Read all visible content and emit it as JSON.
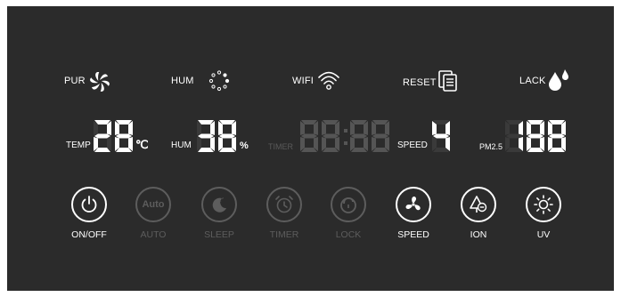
{
  "indicators": {
    "pur": {
      "label": "PUR",
      "icon": "fan-swirl-icon"
    },
    "hum": {
      "label": "HUM",
      "icon": "dots-ring-icon"
    },
    "wifi": {
      "label": "WIFI",
      "icon": "wifi-icon"
    },
    "reset": {
      "label": "RESET",
      "icon": "filter-reset-icon"
    },
    "lack": {
      "label": "LACK",
      "icon": "water-drops-icon"
    }
  },
  "readouts": {
    "temp": {
      "label": "TEMP",
      "value": "28",
      "unit": "℃"
    },
    "hum": {
      "label": "HUM",
      "value": "38",
      "unit": "%"
    },
    "timer": {
      "label": "TIMER",
      "value": "88:88"
    },
    "speed": {
      "label": "SPEED",
      "value": "4"
    },
    "pm25": {
      "label": "PM2.5",
      "value": "188"
    }
  },
  "buttons": [
    {
      "id": "onoff",
      "label": "ON/OFF",
      "icon": "power-icon",
      "active": true
    },
    {
      "id": "auto",
      "label": "AUTO",
      "icon": "auto-icon",
      "inner": "Auto",
      "active": false
    },
    {
      "id": "sleep",
      "label": "SLEEP",
      "icon": "moon-icon",
      "active": false
    },
    {
      "id": "timer",
      "label": "TIMER",
      "icon": "alarm-clock-icon",
      "active": false
    },
    {
      "id": "lock",
      "label": "LOCK",
      "icon": "lock-icon",
      "active": false
    },
    {
      "id": "speed",
      "label": "SPEED",
      "icon": "fan-icon",
      "active": true
    },
    {
      "id": "ion",
      "label": "ION",
      "icon": "ion-tree-icon",
      "active": true
    },
    {
      "id": "uv",
      "label": "UV",
      "icon": "sun-icon",
      "active": true
    }
  ],
  "colors": {
    "panel": "#2b2b2b",
    "lit": "#ffffff",
    "unlit": "#555555"
  }
}
